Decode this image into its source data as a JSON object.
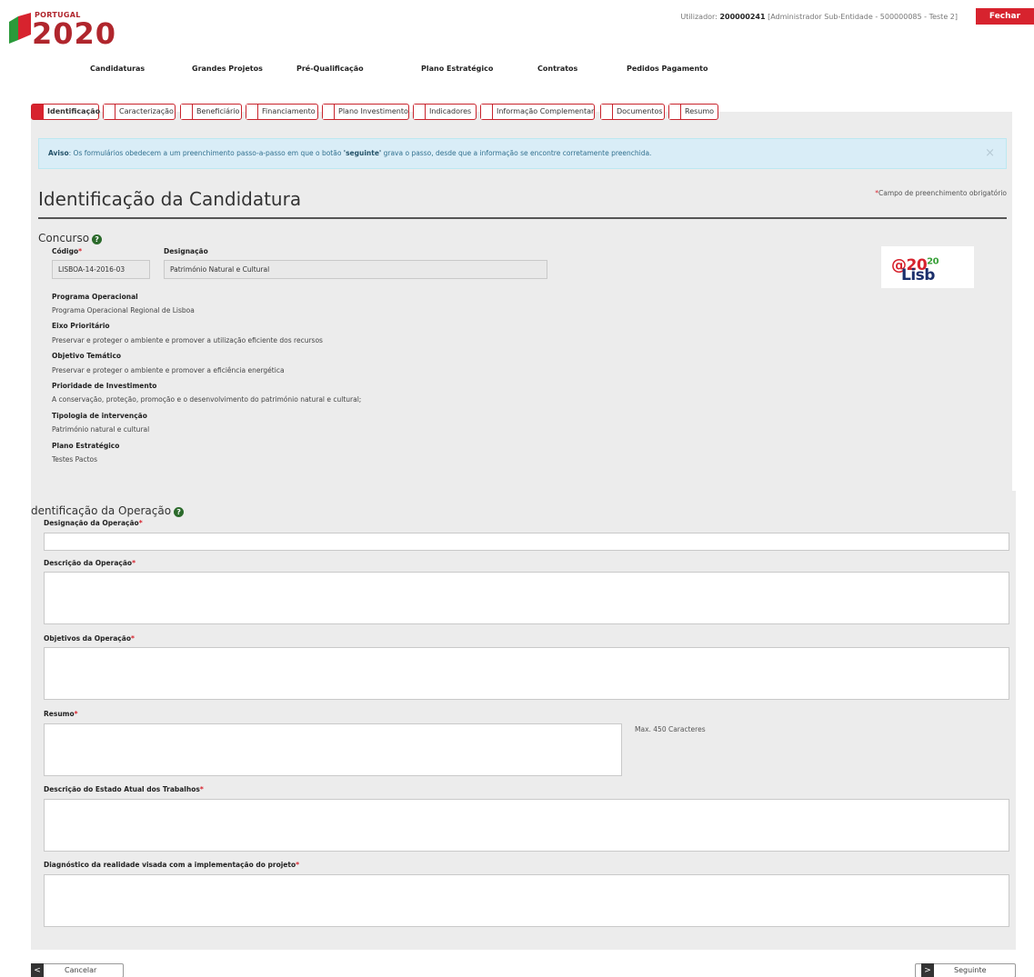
{
  "brand": {
    "country": "PORTUGAL",
    "year": "2020"
  },
  "user": {
    "prefix": "Utilizador: ",
    "id": "200000241",
    "role": " [Administrador Sub-Entidade - 500000085 - Teste 2]",
    "close_label": "Fechar Janela"
  },
  "nav": [
    "Candidaturas",
    "Grandes Projetos",
    "Pré-Qualificação",
    "Plano Estratégico",
    "Contratos",
    "Pedidos Pagamento"
  ],
  "tabs": [
    "Identificação",
    "Caracterização",
    "Beneficiário",
    "Financiamento",
    "Plano Investimento",
    "Indicadores",
    "Informação Complementar",
    "Documentos",
    "Resumo"
  ],
  "alert": {
    "label": "Aviso",
    "text_before": ": Os formulários obedecem a um preenchimento passo-a-passo em que o botão ",
    "highlight": "'seguinte'",
    "text_after": " grava o passo, desde que a informação se encontre corretamente preenchida.",
    "close": "×"
  },
  "page_title": "Identificação da Candidatura",
  "required_note": "Campo de preenchimento obrigatório",
  "required_mark": "*",
  "concurso": {
    "title": "Concurso",
    "codigo_label": "Código",
    "codigo_value": "LISBOA-14-2016-03",
    "designacao_label": "Designação",
    "designacao_value": "Património Natural e Cultural",
    "logo_text_a": "Lisb",
    "logo_text_b": "@20",
    "logo_text_c": "20",
    "details": [
      {
        "label": "Programa Operacional",
        "value": "Programa Operacional Regional de Lisboa"
      },
      {
        "label": "Eixo Prioritário",
        "value": "Preservar e proteger o ambiente e promover a utilização eficiente dos recursos"
      },
      {
        "label": "Objetivo Temático",
        "value": "Preservar e proteger o ambiente e promover a eficiência energética"
      },
      {
        "label": "Prioridade de Investimento",
        "value": "A conservação, proteção, promoção e o desenvolvimento do património natural e cultural;"
      },
      {
        "label": "Tipologia de intervenção",
        "value": "Património natural e cultural"
      },
      {
        "label": "Plano Estratégico",
        "value": "Testes Pactos"
      }
    ]
  },
  "operacao": {
    "title": "dentificação da Operação",
    "designacao_label": "Designação da Operação",
    "descricao_label": "Descrição da Operação",
    "objetivos_label": "Objetivos da Operação",
    "resumo_label": "Resumo",
    "resumo_hint": "Max. 450 Caracteres",
    "estado_label": "Descrição do Estado Atual dos Trabalhos",
    "diagnostico_label": "Diagnóstico da realidade visada com a implementação do projeto"
  },
  "buttons": {
    "cancel": "Cancelar",
    "next": "Seguinte",
    "cancel_icon": "<",
    "next_icon": ">"
  }
}
